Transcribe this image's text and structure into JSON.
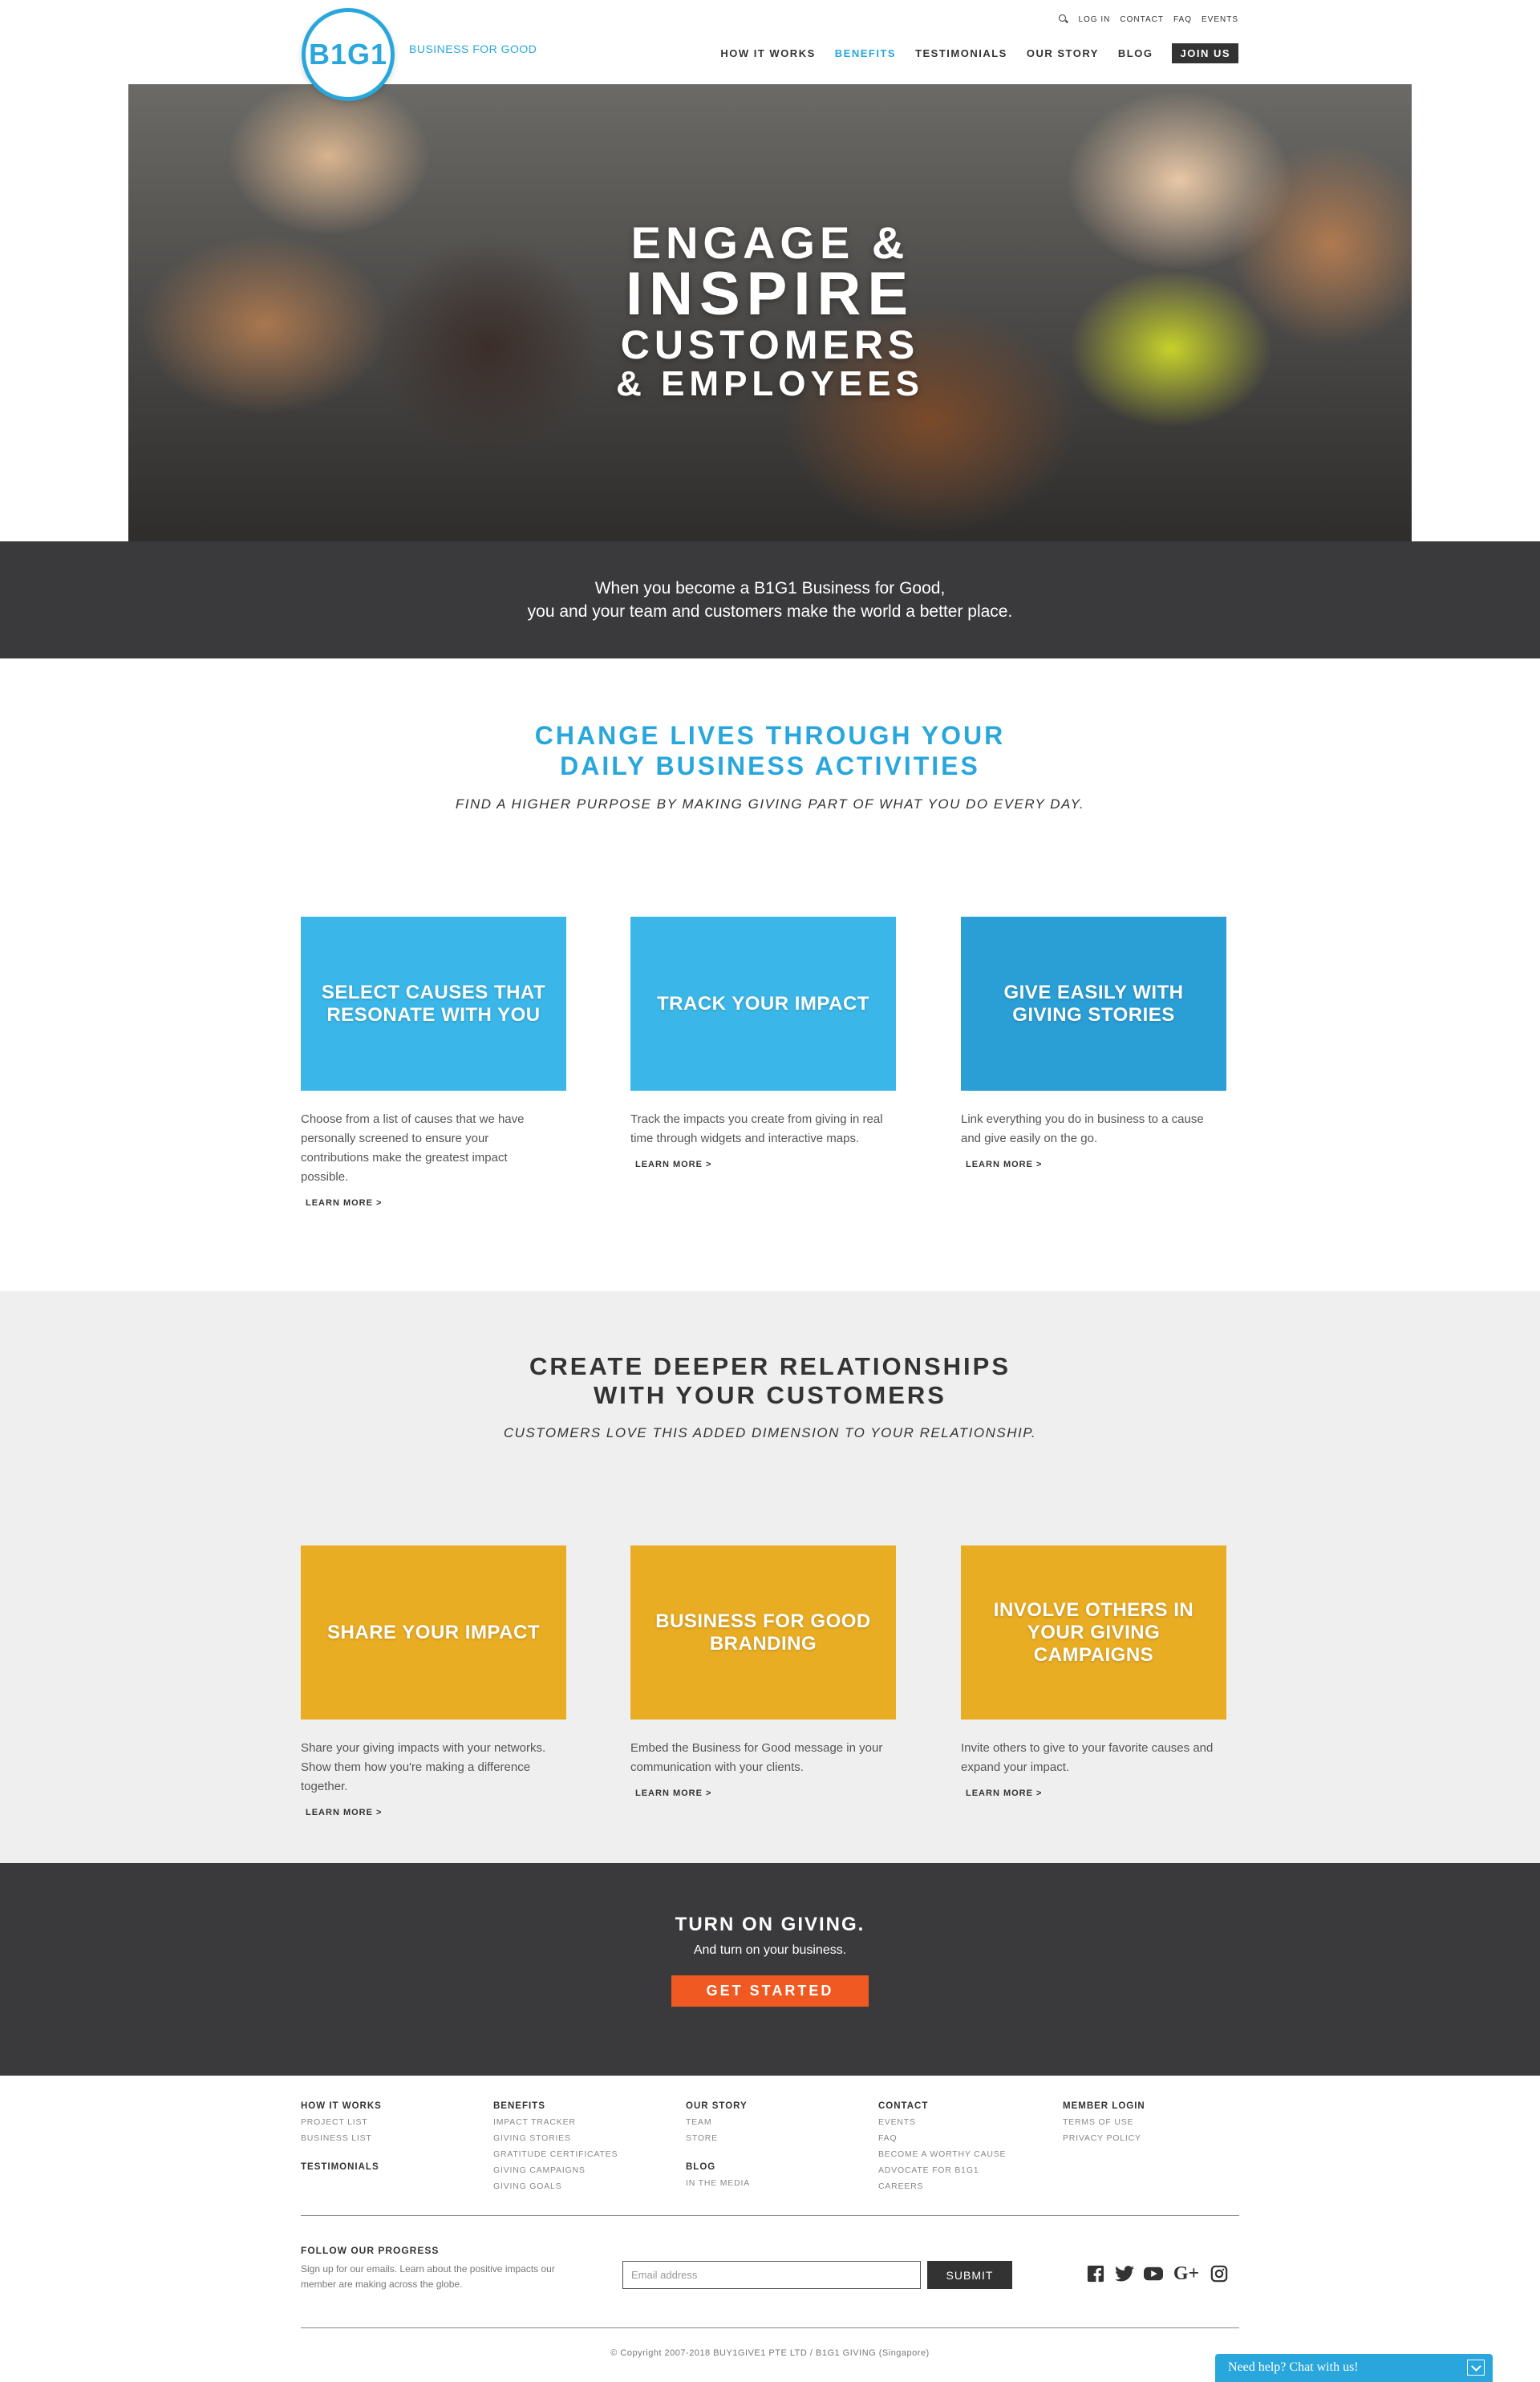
{
  "header": {
    "logo_text": "B1G1",
    "tagline": "BUSINESS FOR GOOD",
    "utility_nav": [
      "LOG IN",
      "CONTACT",
      "FAQ",
      "EVENTS"
    ],
    "main_nav": [
      "HOW IT WORKS",
      "BENEFITS",
      "TESTIMONIALS",
      "OUR STORY",
      "BLOG"
    ],
    "active_nav": "BENEFITS",
    "join_label": "JOIN US"
  },
  "hero": {
    "line1": "ENGAGE &",
    "line2": "INSPIRE",
    "line3": "CUSTOMERS",
    "line4": "& EMPLOYEES"
  },
  "intro": {
    "line1": "When you become a B1G1 Business for Good,",
    "line2": "you and your team and customers make the world a better place."
  },
  "section1": {
    "heading_line1": "CHANGE LIVES THROUGH YOUR",
    "heading_line2": "DAILY BUSINESS ACTIVITIES",
    "subheading": "FIND A HIGHER PURPOSE BY MAKING GIVING PART OF WHAT YOU DO EVERY DAY.",
    "cards": [
      {
        "title": "SELECT CAUSES THAT RESONATE WITH YOU",
        "text": "Choose from a list of causes that we have personally screened to ensure your contributions make the greatest impact possible.",
        "link": "LEARN MORE >"
      },
      {
        "title": "TRACK YOUR IMPACT",
        "text": "Track the impacts you create from giving in real time through widgets and interactive maps.",
        "link": "LEARN MORE >"
      },
      {
        "title": "GIVE EASILY WITH GIVING STORIES",
        "text": "Link everything you do in business to a cause and give easily on the go.",
        "link": "LEARN MORE >"
      }
    ]
  },
  "section2": {
    "heading_line1": "CREATE DEEPER RELATIONSHIPS",
    "heading_line2": "WITH YOUR CUSTOMERS",
    "subheading": "CUSTOMERS LOVE THIS ADDED DIMENSION TO YOUR RELATIONSHIP.",
    "cards": [
      {
        "title": "SHARE YOUR IMPACT",
        "text": "Share your giving impacts with your networks. Show them how you're making a difference together.",
        "link": "LEARN MORE >"
      },
      {
        "title": "BUSINESS FOR GOOD BRANDING",
        "text": "Embed the Business for Good message in your communication with your clients.",
        "link": "LEARN MORE >"
      },
      {
        "title": "INVOLVE OTHERS IN YOUR GIVING CAMPAIGNS",
        "text": "Invite others to give to your favorite causes and expand your impact.",
        "link": "LEARN MORE >"
      }
    ]
  },
  "cta": {
    "title": "TURN ON GIVING.",
    "subtitle": "And turn on your business.",
    "button": "GET STARTED"
  },
  "footer": {
    "col1": {
      "h1": "HOW IT WORKS",
      "items": [
        "PROJECT LIST",
        "BUSINESS LIST"
      ],
      "h2": "TESTIMONIALS"
    },
    "col2": {
      "h1": "BENEFITS",
      "items": [
        "IMPACT TRACKER",
        "GIVING STORIES",
        "GRATITUDE CERTIFICATES",
        "GIVING CAMPAIGNS",
        "GIVING GOALS"
      ]
    },
    "col3": {
      "h1": "OUR STORY",
      "items": [
        "TEAM",
        "STORE"
      ],
      "h2": "BLOG",
      "items2": [
        "IN THE MEDIA"
      ]
    },
    "col4": {
      "h1": "CONTACT",
      "items": [
        "EVENTS",
        "FAQ",
        "BECOME A WORTHY CAUSE",
        "ADVOCATE FOR B1G1",
        "CAREERS"
      ]
    },
    "col5": {
      "h1": "MEMBER LOGIN",
      "items": [
        "TERMS OF USE",
        "PRIVACY POLICY"
      ]
    },
    "follow_title": "FOLLOW OUR PROGRESS",
    "follow_text": "Sign up for our emails. Learn about the positive impacts our member are making across the globe.",
    "email_placeholder": "Email address",
    "submit": "SUBMIT",
    "socials": [
      "facebook-icon",
      "twitter-icon",
      "youtube-icon",
      "google-plus-icon",
      "instagram-icon"
    ],
    "copyright": "© Copyright 2007-2018 BUY1GIVE1 PTE LTD / B1G1 GIVING (Singapore)"
  },
  "chat": {
    "label": "Need help? Chat with us!"
  },
  "colors": {
    "brand_blue": "#29a7dc",
    "dark_band": "#3a393c",
    "cta_orange": "#f05a22",
    "gold": "#e9ad24"
  }
}
